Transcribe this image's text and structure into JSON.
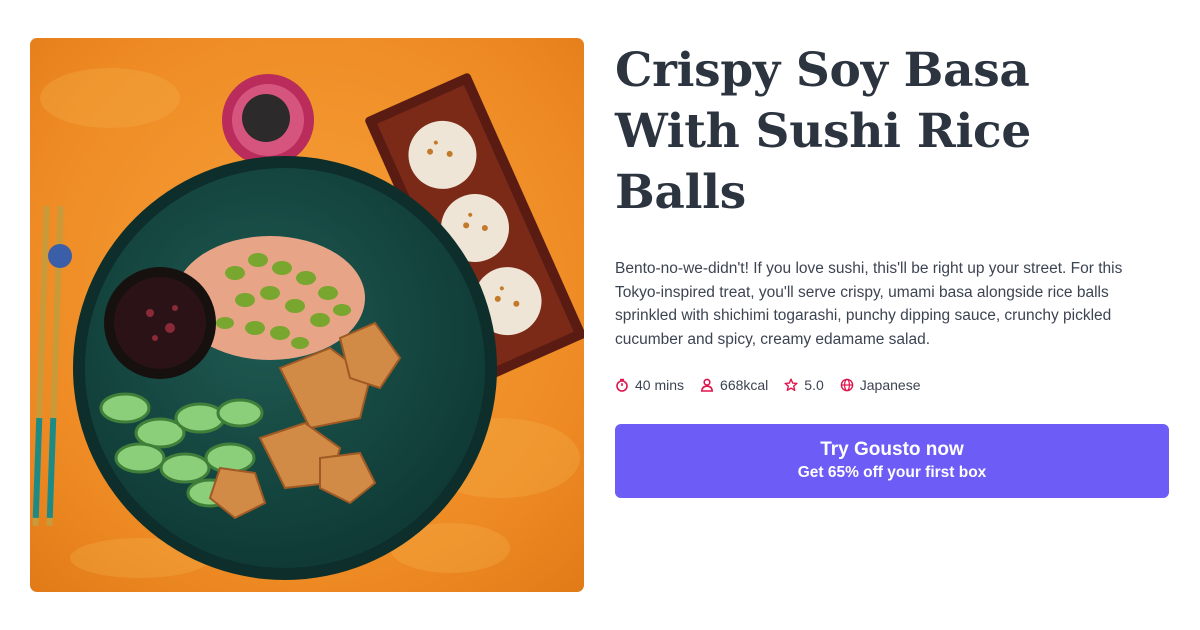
{
  "recipe": {
    "title": "Crispy Soy Basa With Sushi Rice Balls",
    "description": "Bento-no-we-didn't! If you love sushi, this'll be right up your street. For this Tokyo-inspired treat, you'll serve crispy, umami basa alongside rice balls sprinkled with shichimi togarashi, punchy dipping sauce, crunchy pickled cucumber and spicy, creamy edamame salad.",
    "meta": {
      "time": "40 mins",
      "calories": "668kcal",
      "rating": "5.0",
      "cuisine": "Japanese"
    }
  },
  "icons": {
    "time": "stopwatch-icon",
    "calories": "person-icon",
    "rating": "star-icon",
    "cuisine": "globe-icon"
  },
  "cta": {
    "title": "Try Gousto now",
    "subtitle": "Get 65% off your first box"
  },
  "colors": {
    "accent": "#6d5cf5",
    "icon": "#e0144c",
    "title": "#2c3440",
    "text": "#3c4452"
  }
}
